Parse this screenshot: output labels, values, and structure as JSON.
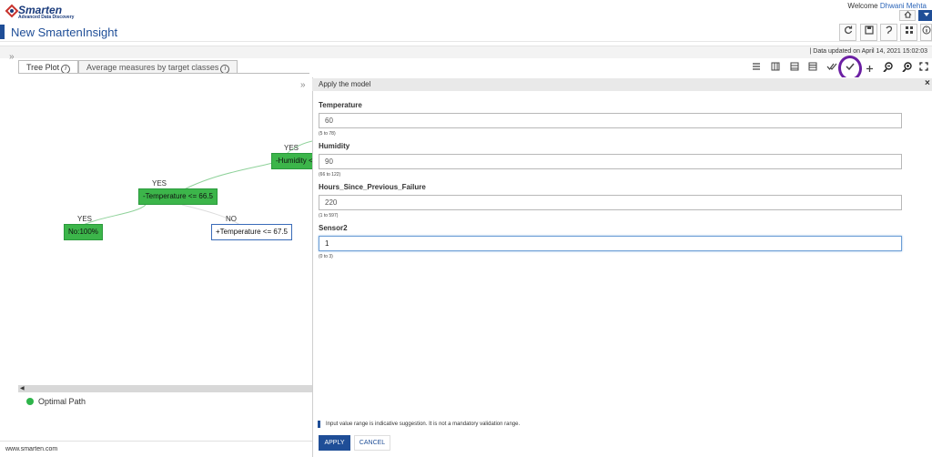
{
  "header": {
    "logo_name": "Smarten",
    "logo_sub": "Advanced Data Discovery",
    "welcome_prefix": "Welcome",
    "user": "Dhwani Mehta",
    "home_icon": "home-icon",
    "menu_icon": "caret-down-icon"
  },
  "titlebar": {
    "title": "New SmartenInsight",
    "tools": [
      "refresh-icon",
      "save-icon",
      "share-icon",
      "grid-icon",
      "info-icon"
    ]
  },
  "status": {
    "data_updated": "|  Data updated on April 14, 2021 15:02:03"
  },
  "tabs": [
    {
      "label": "Tree Plot",
      "active": true
    },
    {
      "label": "Average measures by target classes",
      "active": false
    }
  ],
  "tree": {
    "nodes": [
      {
        "label": "-Humidity <="
      },
      {
        "label": "-Temperature <= 66.5"
      },
      {
        "label": "No:100%"
      },
      {
        "label": "+Temperature <= 67.5"
      }
    ],
    "edges": [
      "YES",
      "YES",
      "YES",
      "NO"
    ],
    "legend": "Optimal Path"
  },
  "footer": {
    "site": "www.smarten.com"
  },
  "modal": {
    "title": "Apply the model",
    "fields": [
      {
        "label": "Temperature",
        "value": "60",
        "hint": "(5 to 78)"
      },
      {
        "label": "Humidity",
        "value": "90",
        "hint": "(66 to 122)"
      },
      {
        "label": "Hours_Since_Previous_Failure",
        "value": "220",
        "hint": "(1 to 597)"
      },
      {
        "label": "Sensor2",
        "value": "1",
        "hint": "(0 to 3)"
      }
    ],
    "note": "Input value range is indicative suggestion. It is not a mandatory validation range.",
    "apply_label": "APPLY",
    "cancel_label": "CANCEL"
  },
  "colors": {
    "brand": "#1f4e97",
    "node_green": "#3cb54a",
    "highlight_ring": "#6b1fa3"
  }
}
